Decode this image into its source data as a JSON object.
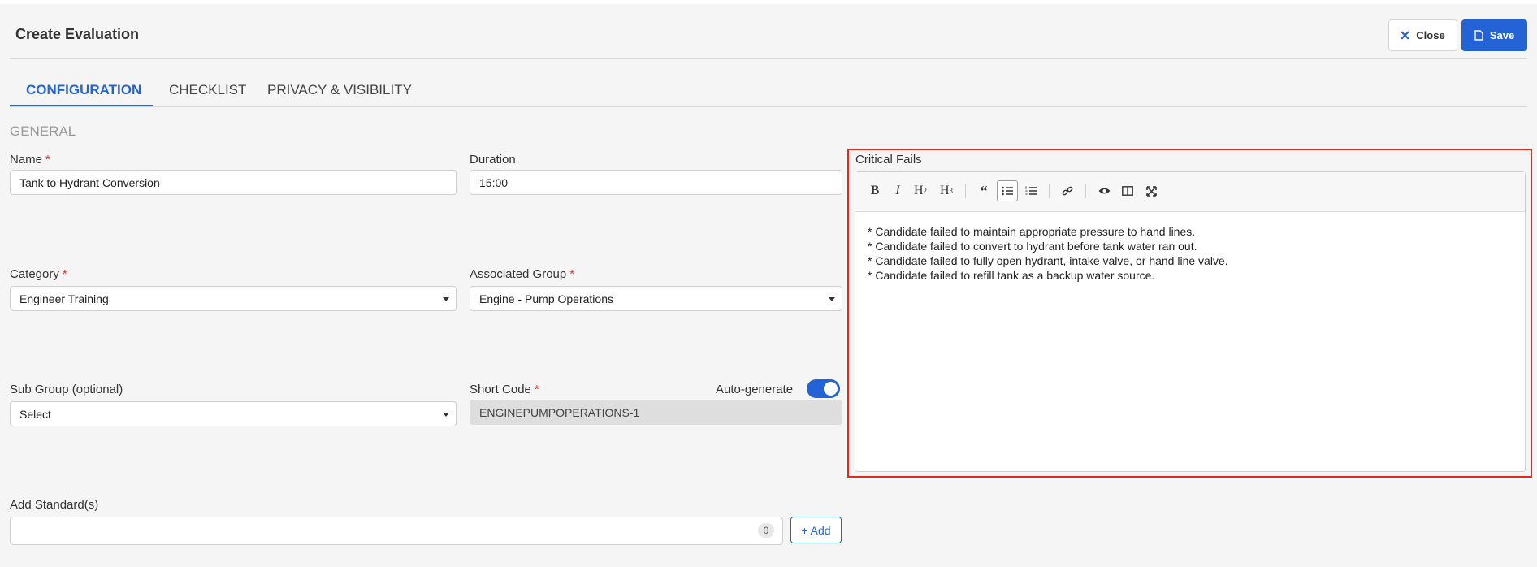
{
  "header": {
    "title": "Create Evaluation",
    "close_label": "Close",
    "save_label": "Save"
  },
  "tabs": [
    {
      "label": "CONFIGURATION",
      "active": true
    },
    {
      "label": "CHECKLIST",
      "active": false
    },
    {
      "label": "PRIVACY & VISIBILITY",
      "active": false
    }
  ],
  "section_title": "GENERAL",
  "fields": {
    "name": {
      "label": "Name",
      "required": "*",
      "value": "Tank to Hydrant Conversion"
    },
    "duration": {
      "label": "Duration",
      "value": "15:00"
    },
    "category": {
      "label": "Category",
      "required": "*",
      "value": "Engineer Training"
    },
    "associated_group": {
      "label": "Associated Group",
      "required": "*",
      "value": "Engine - Pump Operations"
    },
    "sub_group": {
      "label": "Sub Group (optional)",
      "value": "Select"
    },
    "short_code": {
      "label": "Short Code",
      "required": "*",
      "value": "ENGINEPUMPOPERATIONS-1",
      "auto_generate_label": "Auto-generate",
      "auto_generate_on": true
    },
    "standards": {
      "label": "Add Standard(s)",
      "count": "0",
      "add_label": "+ Add"
    }
  },
  "critical_fails": {
    "label": "Critical Fails",
    "toolbar": [
      "bold-icon",
      "italic-icon",
      "heading-2-icon",
      "heading-3-icon",
      "quote-icon",
      "bulleted-list-icon",
      "numbered-list-icon",
      "link-icon",
      "preview-icon",
      "side-by-side-icon",
      "fullscreen-icon"
    ],
    "lines": [
      "* Candidate failed to maintain appropriate pressure to hand lines.",
      "* Candidate failed to convert to hydrant before tank water ran out.",
      "* Candidate failed to fully open hydrant, intake valve, or hand line valve.",
      "* Candidate failed to refill tank as a backup water source."
    ]
  },
  "colors": {
    "accent": "#2463d6",
    "required": "#d6342c",
    "highlight": "#e0291f"
  }
}
